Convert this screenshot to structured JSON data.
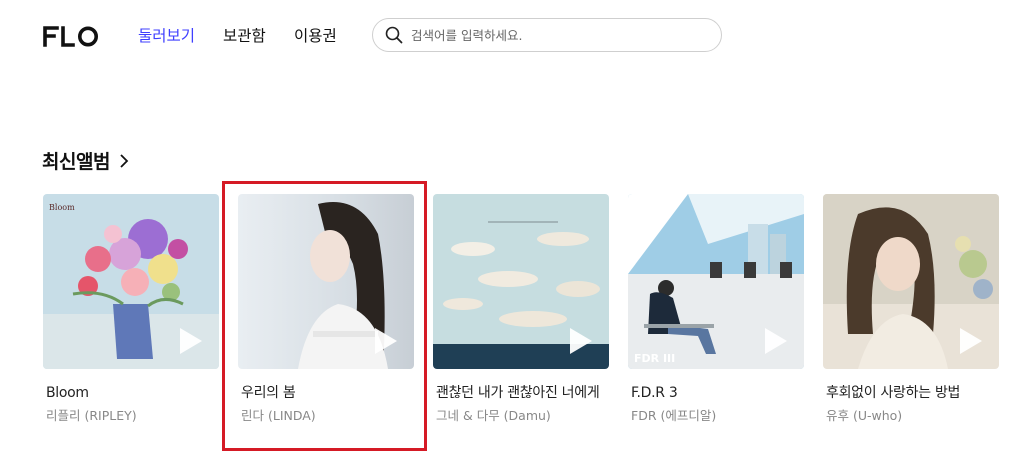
{
  "brand": {
    "logo_text": "FLO"
  },
  "nav": {
    "items": [
      {
        "label": "둘러보기"
      },
      {
        "label": "보관함"
      },
      {
        "label": "이용권"
      }
    ]
  },
  "search": {
    "placeholder": "검색어를 입력하세요."
  },
  "section": {
    "title": "최신앨범"
  },
  "albums": [
    {
      "title": "Bloom",
      "artist": "리플리 (RIPLEY)",
      "cover_text": "Bloom"
    },
    {
      "title": "우리의 봄",
      "artist": "린다 (LINDA)"
    },
    {
      "title": "괜찮던 내가 괜찮아진 너에게",
      "artist": "그네 & 다무 (Damu)"
    },
    {
      "title": "F.D.R 3",
      "artist": "FDR (에프디알)",
      "cover_text": "FDR III"
    },
    {
      "title": "후회없이 사랑하는 방법",
      "artist": "유후 (U-who)"
    }
  ],
  "colors": {
    "accent": "#3f3fff",
    "highlight": "#d51a25"
  }
}
